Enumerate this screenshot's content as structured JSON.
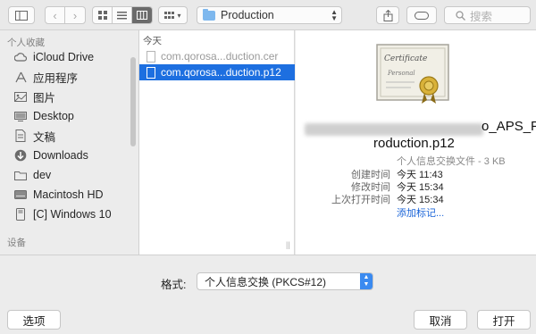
{
  "toolbar": {
    "path_folder": "Production",
    "search_placeholder": "搜索"
  },
  "sidebar": {
    "favorites_header": "个人收藏",
    "devices_header": "设备",
    "items": [
      {
        "label": "iCloud Drive",
        "icon": "cloud-icon"
      },
      {
        "label": "应用程序",
        "icon": "applications-icon"
      },
      {
        "label": "图片",
        "icon": "pictures-icon"
      },
      {
        "label": "Desktop",
        "icon": "desktop-icon"
      },
      {
        "label": "文稿",
        "icon": "documents-icon"
      },
      {
        "label": "Downloads",
        "icon": "downloads-icon"
      },
      {
        "label": "dev",
        "icon": "folder-icon"
      },
      {
        "label": "Macintosh HD",
        "icon": "hard-drive-icon"
      },
      {
        "label": "[C] Windows 10",
        "icon": "disk-icon"
      }
    ]
  },
  "file_column": {
    "header": "今天",
    "files": [
      {
        "name": "com.qorosa...duction.cer",
        "selected": false
      },
      {
        "name": "com.qorosa...duction.p12",
        "selected": true
      }
    ]
  },
  "preview": {
    "cert_text_1": "Certificate",
    "cert_text_2": "Personal",
    "name_line1": "o_APS_P",
    "name_line2": "roduction.p12",
    "kind": "个人信息交换文件 - 3 KB",
    "created_label": "创建时间",
    "created_value": "今天 11:43",
    "modified_label": "修改时间",
    "modified_value": "今天 15:34",
    "opened_label": "上次打开时间",
    "opened_value": "今天 15:34",
    "add_tags": "添加标记..."
  },
  "format": {
    "label": "格式:",
    "selected": "个人信息交换 (PKCS#12)"
  },
  "buttons": {
    "options": "选项",
    "cancel": "取消",
    "open": "打开"
  },
  "colors": {
    "selection": "#1d6fe0",
    "link": "#1a64d8",
    "popup_accent": "#3a8af0"
  }
}
